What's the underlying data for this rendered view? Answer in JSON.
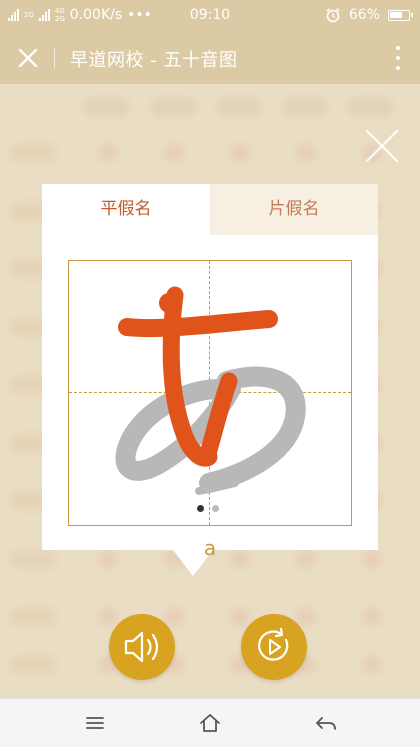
{
  "status_bar": {
    "network_tags": [
      "2G",
      "4G",
      "4G",
      "2G"
    ],
    "speed": "0.00K/s",
    "more": "•••",
    "time": "09:10",
    "battery": "66%"
  },
  "app_bar": {
    "title": "早道网校 - 五十音图",
    "close_icon": "close-icon",
    "more_icon": "more-vertical-icon"
  },
  "overlay": {
    "close_icon": "close-icon",
    "tabs": [
      {
        "label": "平假名",
        "active": true
      },
      {
        "label": "片假名",
        "active": false
      }
    ],
    "romaji": "a",
    "page_indicator": {
      "count": 2,
      "current": 1
    }
  },
  "actions": {
    "sound_icon": "speaker-icon",
    "play_icon": "play-stroke-icon"
  },
  "nav_bar": {
    "menu_icon": "menu-icon",
    "home_icon": "home-icon",
    "back_icon": "back-icon"
  },
  "colors": {
    "header": "#dccaa4",
    "accent_orange": "#e0541b",
    "gold": "#d8a321",
    "tab_active_text": "#c35a2c",
    "tab_inactive_bg": "#f7efe2",
    "grid_line": "#c99a3b"
  }
}
